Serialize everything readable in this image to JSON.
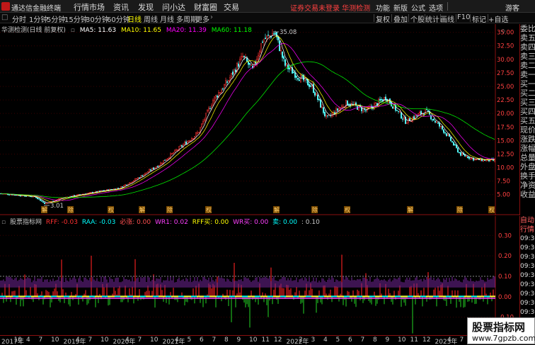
{
  "titlebar": {
    "app_name": "通达信金融终端",
    "menus": [
      "行情",
      "市场",
      "资讯",
      "发现",
      "问小达",
      "财富圈",
      "交易"
    ],
    "notice": "证券交易未登录  华测检测",
    "right_menus": [
      "功能",
      "新版",
      "公式",
      "选项",
      "游客"
    ]
  },
  "toolbar": {
    "timeframes": [
      "分时",
      "1分钟",
      "5分钟",
      "15分钟",
      "30分钟",
      "60分钟",
      "日线",
      "周线",
      "月线",
      "多周期",
      "更多"
    ],
    "active_timeframe": "日线",
    "buttons": [
      "复权",
      "叠加",
      "个股",
      "统计",
      "画线",
      "F10",
      "标记",
      "+自选"
    ]
  },
  "main_chart": {
    "title": "华测检测(日线 前复权)",
    "ma": [
      {
        "label": "MA5: 11.63",
        "color": "#ffffff"
      },
      {
        "label": "MA10: 11.65",
        "color": "#ffff00"
      },
      {
        "label": "MA20: 11.39",
        "color": "#ff00ff"
      },
      {
        "label": "MA60: 11.18",
        "color": "#00ff00"
      }
    ],
    "price_labels": [
      "35.00",
      "32.50",
      "30.00",
      "27.50",
      "25.00",
      "22.50",
      "20.00",
      "17.50",
      "15.00",
      "12.50",
      "10.00",
      "7.50",
      "5.00"
    ],
    "high_label": "35.08",
    "low_label": "3.01",
    "event_markers": [
      "解",
      "除",
      "权"
    ],
    "right_marker": "除"
  },
  "indicator": {
    "name": "股票指标网",
    "items": [
      {
        "label": "RFF: -0.03",
        "color": "#ff3030"
      },
      {
        "label": "RAA: -0.03",
        "color": "#00ffff"
      },
      {
        "label": "必涨: 0.00",
        "color": "#ff5050"
      },
      {
        "label": "WR1: 0.02",
        "color": "#ff40ff"
      },
      {
        "label": "RFF买: 0.00",
        "color": "#ffff00"
      },
      {
        "label": "WR买: 0.00",
        "color": "#ff40ff"
      },
      {
        "label": "卖: 0.00",
        "color": "#00ffff"
      },
      {
        "label": ": 0.10",
        "color": "#c8c8c8"
      }
    ],
    "axis_labels": [
      "0.30",
      "0.20",
      "0.10",
      "0.00",
      "-0.10"
    ]
  },
  "quote_panel": {
    "items": [
      "委比",
      "卖五",
      "卖四",
      "卖三",
      "卖二",
      "卖一",
      "买一",
      "买二",
      "买三",
      "买四",
      "买五",
      "现价",
      "涨跌",
      "涨幅",
      "总量",
      "外盘",
      "换手",
      "净资",
      "收益"
    ]
  },
  "mini_panel": {
    "items": [
      "自动",
      "行情",
      "09:30",
      "09:30",
      "09:30",
      "09:30",
      "09:30",
      "09:30",
      "09:30",
      "09:30",
      "09:30",
      "09:30"
    ]
  },
  "time_axis": {
    "labels": [
      "2017年",
      "10",
      "4",
      "7",
      "10",
      "2019年",
      "4",
      "7",
      "10",
      "2020年",
      "4",
      "7",
      "10",
      "2021年",
      "4",
      "5",
      "6",
      "7",
      "8",
      "9",
      "10",
      "11",
      "12",
      "2022年",
      "2",
      "3",
      "4",
      "5",
      "6",
      "7",
      "8",
      "9",
      "10",
      "11",
      "12",
      "2023年",
      "4",
      "7",
      "10",
      "12"
    ]
  },
  "watermark": {
    "line1": "股票指标网",
    "line2": "www.7gpzb.com"
  }
}
